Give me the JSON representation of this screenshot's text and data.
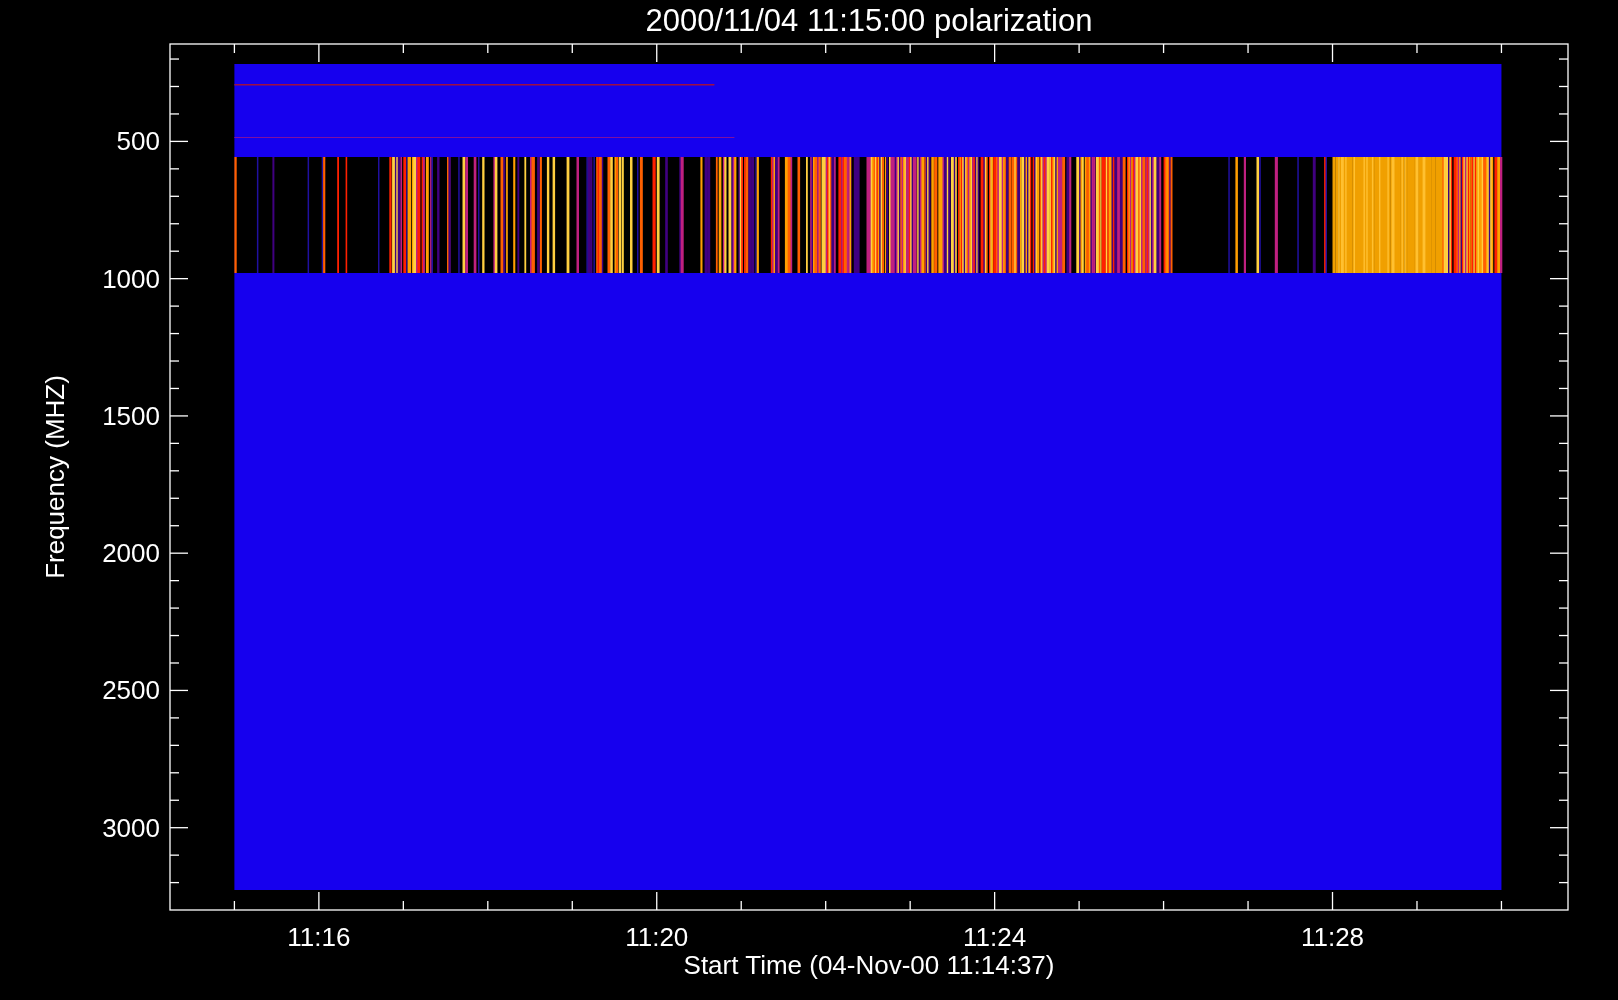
{
  "title": "2000/11/04 11:15:00 polarization",
  "y_axis": {
    "label": "Frequency (MHZ)",
    "ticks": [
      "500",
      "1000",
      "1500",
      "2000",
      "2500",
      "3000"
    ]
  },
  "x_axis": {
    "label": "Start Time (04-Nov-00 11:14:37)",
    "ticks": [
      "11:16",
      "11:20",
      "11:24",
      "11:28"
    ]
  }
}
